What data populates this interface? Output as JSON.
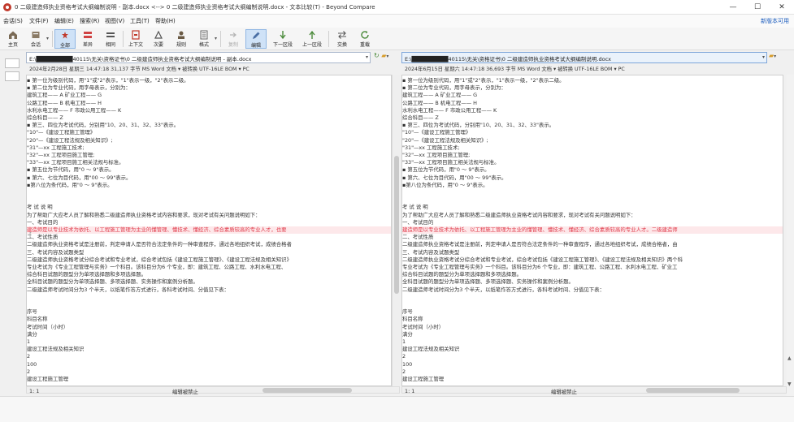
{
  "window": {
    "title": "0 二级建造师执业资格考试大纲编制说明 - 副本.docx <--> 0 二级建造师执业资格考试大纲编制说明.docx - 文本比较(T) - Beyond Compare",
    "min": "—",
    "max": "☐",
    "close": "✕"
  },
  "menu": {
    "items": [
      "会话(S)",
      "文件(F)",
      "编辑(E)",
      "搜索(R)",
      "视图(V)",
      "工具(T)",
      "帮助(H)"
    ],
    "new_version": "新版本可用"
  },
  "toolbar": {
    "home": "主页",
    "session": "会话",
    "all": "全部",
    "diffs": "差异",
    "same": "相同",
    "context": "上下文",
    "minor": "次要",
    "rules": "规则",
    "format": "格式",
    "copy": "复制",
    "edit": "编辑",
    "next_section": "下一区段",
    "prev_section": "上一区段",
    "swap": "交换",
    "reload": "重载"
  },
  "left": {
    "path": "E:\\█████████40115\\无关\\资格证书\\0 二级建造师执业资格考试大纲编制说明 - 副本.docx",
    "info": "2024年2月28日 星期三 14:47:18    31,137 字节    MS Word 文档  ▾  被转换    UTF-16LE BOM  ▾  PC",
    "status_pos": "1: 1",
    "status_mode": "编辑被禁止"
  },
  "right": {
    "path": "E:\\█████████40115\\无关\\资格证书\\0 二级建造师执业资格考试大纲编制说明.docx",
    "info": "2024年6月15日 星期六 14:47:18    36,693 字节    MS Word 文档  ▾  被转换    UTF-16LE BOM  ▾  PC",
    "status_pos": "1: 1",
    "status_mode": "编辑被禁止"
  },
  "left_lines": [
    {
      "text": "  ▪  第一位为级别代码，用\"1\"或\"2\"表示，\"1\"表示一级，\"2\"表示二级。",
      "diff": false
    },
    {
      "text": "  ▪  第二位为专业代码，用字母表示，分别为：",
      "diff": false
    },
    {
      "text": "  建筑工程——  A        矿业工程——  G",
      "diff": false
    },
    {
      "text": "  公路工程——  B        机电工程——  H",
      "diff": false
    },
    {
      "text": "  水利水电工程——  F      市政公用工程——  K",
      "diff": false
    },
    {
      "text": "  综合科目——  Z",
      "diff": false
    },
    {
      "text": "  ▪  第三、四位为考试代码，分别用\"10、20、31、32、33\"表示。",
      "diff": false
    },
    {
      "text": "  \"10\"—《建设工程施工管理》",
      "diff": false
    },
    {
      "text": "  \"20\"—《建设工程法规及相关知识》;",
      "diff": false
    },
    {
      "text": "  \"31\"—xx 工程施工技术;",
      "diff": false
    },
    {
      "text": "  \"32\"—xx 工程项目施工管理;",
      "diff": false
    },
    {
      "text": "  \"33\"—xx 工程项目施工相关法规与标准。",
      "diff": false
    },
    {
      "text": "  ▪  第五位为节代码，用\"0 ～ 9\"表示。",
      "diff": false
    },
    {
      "text": "  ▪  第六、七位为目代码，用\"00 ～ 99\"表示。",
      "diff": false
    },
    {
      "text": "  ▪第八位为条代码，用\"0 ～ 9\"表示。",
      "diff": false
    },
    {
      "text": "",
      "diff": false
    },
    {
      "text": "",
      "diff": false
    },
    {
      "text": "  考  试  说  明",
      "diff": false
    },
    {
      "text": "  为了帮助广大应考人员了解和熟悉二级建造师执业资格考试内容和要求，现对考试有关问题说明如下：",
      "diff": false
    },
    {
      "text": "  一、考试目的",
      "diff": false
    },
    {
      "text": "  建造师是以专业技术为依托、以工程施工管理为主业的懂管理、懂技术、懂经济、综合素质较高的专业人才，也要",
      "diff": true
    },
    {
      "text": "  二、考试性质",
      "diff": false
    },
    {
      "text": "  二级建造师执业资格考试是注册前，判定申请人是否符合法定条件的一种审查程序，通过各地组织考试，成绩合格者",
      "diff": false
    },
    {
      "text": "  三、考试内容及试题类型",
      "diff": false
    },
    {
      "text": "  二级建造师执业资格考试分综合考试和专业考试，综合考试包括《建设工程施工管理》、《建设工程法规及相关知识》",
      "diff": false
    },
    {
      "text": "  专业考试为《专业工程管理与实务》一个科目。该科目分为6 个专业，即：建筑工程、公路工程、水利水电工程、",
      "diff": false
    },
    {
      "text": "  综合科目试题的题型分为单项选择题和多项选择题。",
      "diff": false
    },
    {
      "text": "  全科目试题的题型分为单项选择题、多项选择题、实务操作和案例分析题。",
      "diff": false
    },
    {
      "text": "  二级建造师考试时间分为3 个半天，以纸笔作答方式进行，各科考试时间、分值见下表：",
      "diff": false
    },
    {
      "text": "",
      "diff": false
    },
    {
      "text": "",
      "diff": false
    },
    {
      "text": "  序号",
      "diff": false
    },
    {
      "text": "  科目名称",
      "diff": false
    },
    {
      "text": "  考试时间（小时）",
      "diff": false
    },
    {
      "text": "  满分",
      "diff": false
    },
    {
      "text": "  1",
      "diff": false
    },
    {
      "text": "  建设工程法规及相关知识",
      "diff": false
    },
    {
      "text": "  2",
      "diff": false
    },
    {
      "text": "  100",
      "diff": false
    },
    {
      "text": "  2",
      "diff": false
    },
    {
      "text": "  建设工程施工管理",
      "diff": false
    }
  ],
  "right_lines": [
    {
      "text": "  ▪  第一位为级别代码，用\"1\"或\"2\"表示，\"1\"表示一级，\"2\"表示二级。",
      "diff": false
    },
    {
      "text": "  ▪  第二位为专业代码，用字母表示，分别为：",
      "diff": false
    },
    {
      "text": "  建筑工程——  A        矿业工程——  G",
      "diff": false
    },
    {
      "text": "  公路工程——  B        机电工程——  H",
      "diff": false
    },
    {
      "text": "  水利水电工程——  F      市政公用工程——  K",
      "diff": false
    },
    {
      "text": "  综合科目——  Z",
      "diff": false
    },
    {
      "text": "  ▪  第三、四位为考试代码，分别用\"10、20、31、32、33\"表示。",
      "diff": false
    },
    {
      "text": "  \"10\"—《建设工程施工管理》",
      "diff": false
    },
    {
      "text": "  \"20\"—《建设工程法规及相关知识》;",
      "diff": false
    },
    {
      "text": "  \"31\"—xx 工程施工技术;",
      "diff": false
    },
    {
      "text": "  \"32\"—xx 工程项目施工管理;",
      "diff": false
    },
    {
      "text": "  \"33\"—xx 工程项目施工相关法规与标准。",
      "diff": false
    },
    {
      "text": "  ▪  第五位为节代码，用\"0 ～ 9\"表示。",
      "diff": false
    },
    {
      "text": "  ▪  第六、七位为目代码，用\"00 ～ 99\"表示。",
      "diff": false
    },
    {
      "text": "  ▪第八位为条代码，用\"0 ～ 9\"表示。",
      "diff": false
    },
    {
      "text": "",
      "diff": false
    },
    {
      "text": "",
      "diff": false
    },
    {
      "text": "  考  试  说  明",
      "diff": false
    },
    {
      "text": "  为了帮助广大应考人员了解和熟悉二级建造师执业资格考试内容和要求，现对考试有关问题说明如下：",
      "diff": false
    },
    {
      "text": "  一、考试目的",
      "diff": false
    },
    {
      "text": "  建造师是以专业技术为依托、以工程施工管理为主业的懂管理、懂技术、懂经济、综合素质较高的专业人才。二级建造师",
      "diff": true
    },
    {
      "text": "  二、考试性质",
      "diff": false
    },
    {
      "text": "  二级建造师执业资格考试是注册前，判定申请人是否符合法定条件的一种审查程序，通过各地组织考试，成绩合格者，由",
      "diff": false
    },
    {
      "text": "  三、考试内容及试题类型",
      "diff": false
    },
    {
      "text": "  二级建造师执业资格考试分综合考试和专业考试，综合考试包括《建设工程施工管理》、《建设工程法规及相关知识》两个科",
      "diff": false
    },
    {
      "text": "  专业考试为《专业工程管理与实务》一个科目。该科目分为6 个专业，即：建筑工程、公路工程、水利水电工程、矿业工",
      "diff": false
    },
    {
      "text": "  综合科目试题的题型分为单项选择题和多项选择题。",
      "diff": false
    },
    {
      "text": "  全科目试题的题型分为单项选择题、多项选择题、实务操作和案例分析题。",
      "diff": false
    },
    {
      "text": "  二级建造师考试时间分为3 个半天，以纸笔作答方式进行，各科考试时间、分值见下表：",
      "diff": false
    },
    {
      "text": "",
      "diff": false
    },
    {
      "text": "",
      "diff": false
    },
    {
      "text": "  序号",
      "diff": false
    },
    {
      "text": "  科目名称",
      "diff": false
    },
    {
      "text": "  考试时间（小时）",
      "diff": false
    },
    {
      "text": "  满分",
      "diff": false
    },
    {
      "text": "  1",
      "diff": false
    },
    {
      "text": "  建设工程法规及相关知识",
      "diff": false
    },
    {
      "text": "  2",
      "diff": false
    },
    {
      "text": "  100",
      "diff": false
    },
    {
      "text": "  2",
      "diff": false
    },
    {
      "text": "  建设工程施工管理",
      "diff": false
    }
  ],
  "colors": {
    "diff_text": "#e03a4a",
    "diff_bg": "#fde8ea",
    "accent": "#1f5fbf"
  }
}
